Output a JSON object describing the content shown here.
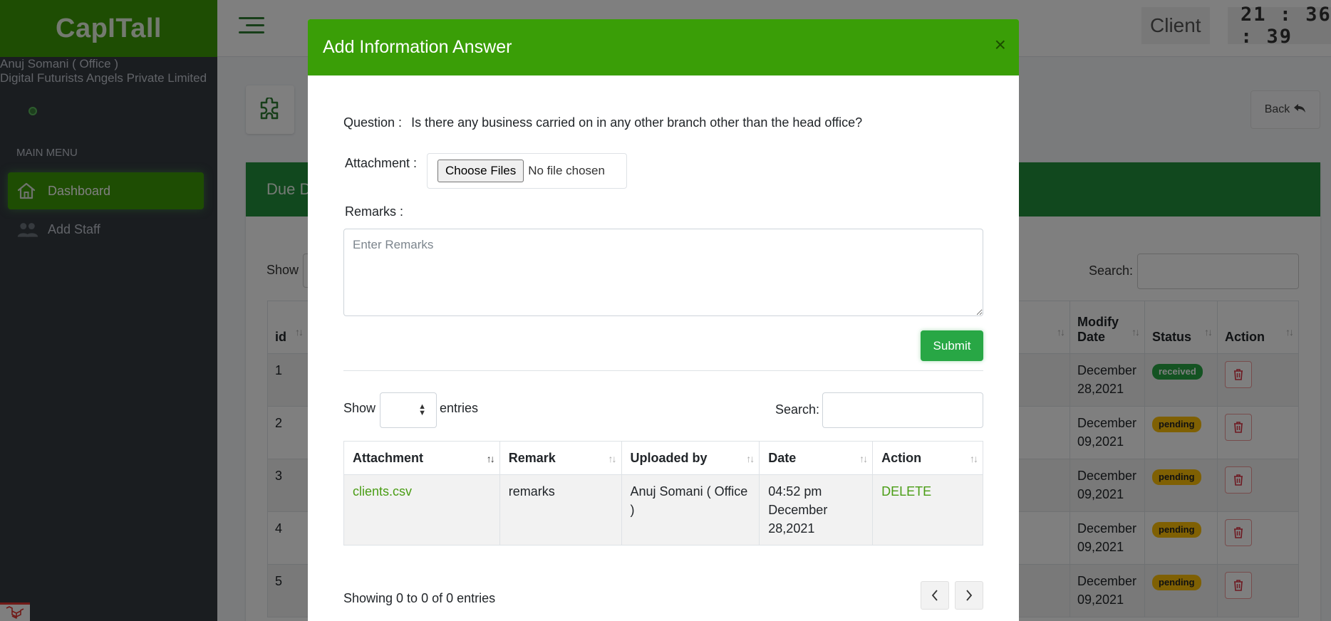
{
  "app": {
    "brand": "CapITall",
    "client_label": "Client",
    "clock": "21 : 36 : 39"
  },
  "user": {
    "name": "Anuj Somani ( Office )",
    "company": "Digital Futurists Angels Private Limited"
  },
  "sidebar": {
    "menu_header": "MAIN MENU",
    "items": [
      {
        "label": "Dashboard",
        "icon": "home-icon",
        "active": true
      },
      {
        "label": "Add Staff",
        "icon": "users-icon",
        "active": false
      }
    ]
  },
  "page": {
    "back_label": "Back",
    "card_title": "Due D",
    "show_label": "Show",
    "search_label": "Search:",
    "columns": [
      "id",
      "Modify Date",
      "Status",
      "Action"
    ],
    "rows": [
      {
        "id": "1",
        "modify_date": "December 28,2021",
        "status": "received"
      },
      {
        "id": "2",
        "modify_date": "December 09,2021",
        "status": "pending"
      },
      {
        "id": "3",
        "modify_date": "December 09,2021",
        "status": "pending"
      },
      {
        "id": "4",
        "modify_date": "December 09,2021",
        "status": "pending"
      },
      {
        "id": "5",
        "modify_date": "December 09,2021",
        "status": "pending"
      }
    ]
  },
  "modal": {
    "title": "Add Information Answer",
    "close": "×",
    "question_label": "Question :",
    "question_text": "Is there any business carried on in any other branch other than the head office?",
    "attachment_label": "Attachment :",
    "choose_files": "Choose Files",
    "no_file": "No file chosen",
    "remarks_label": "Remarks :",
    "remarks_placeholder": "Enter Remarks",
    "submit_label": "Submit",
    "show_label": "Show",
    "entries_label": "entries",
    "search_label": "Search:",
    "table": {
      "columns": [
        "Attachment",
        "Remark",
        "Uploaded by",
        "Date",
        "Action"
      ],
      "rows": [
        {
          "attachment": "clients.csv",
          "remark": "remarks",
          "uploaded_by": "Anuj Somani ( Office )",
          "date": "04:52 pm December 28,2021",
          "action": "DELETE"
        }
      ]
    },
    "info": "Showing 0 to 0 of 0 entries"
  },
  "colors": {
    "brand_green": "#3c9a06",
    "header_green": "#23903d",
    "submit_green": "#28a745",
    "received": "#28a745",
    "pending": "#ffc107",
    "link_green": "#4a9d15"
  }
}
